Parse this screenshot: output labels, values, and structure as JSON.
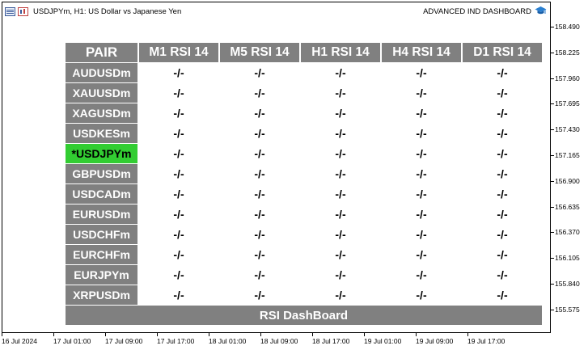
{
  "window": {
    "title": "USDJPYm, H1:  US Dollar vs Japanese Yen",
    "ea_name": "ADVANCED IND DASHBOARD"
  },
  "price_axis": [
    "158.490",
    "158.225",
    "157.960",
    "157.695",
    "157.430",
    "157.165",
    "156.900",
    "156.635",
    "156.370",
    "156.105",
    "155.840",
    "155.575"
  ],
  "time_axis": [
    "16 Jul 2024",
    "17 Jul 01:00",
    "17 Jul 09:00",
    "17 Jul 17:00",
    "18 Jul 01:00",
    "18 Jul 09:00",
    "18 Jul 17:00",
    "19 Jul 01:00",
    "19 Jul 09:00",
    "19 Jul 17:00"
  ],
  "dashboard": {
    "header": [
      "PAIR",
      "M1 RSI 14",
      "M5 RSI 14",
      "H1 RSI 14",
      "H4 RSI 14",
      "D1 RSI 14"
    ],
    "rows": [
      {
        "pair": "AUDUSDm",
        "values": [
          "-/-",
          "-/-",
          "-/-",
          "-/-",
          "-/-"
        ]
      },
      {
        "pair": "XAUUSDm",
        "values": [
          "-/-",
          "-/-",
          "-/-",
          "-/-",
          "-/-"
        ]
      },
      {
        "pair": "XAGUSDm",
        "values": [
          "-/-",
          "-/-",
          "-/-",
          "-/-",
          "-/-"
        ]
      },
      {
        "pair": "USDKESm",
        "values": [
          "-/-",
          "-/-",
          "-/-",
          "-/-",
          "-/-"
        ]
      },
      {
        "pair": "*USDJPYm",
        "values": [
          "-/-",
          "-/-",
          "-/-",
          "-/-",
          "-/-"
        ],
        "active": true
      },
      {
        "pair": "GBPUSDm",
        "values": [
          "-/-",
          "-/-",
          "-/-",
          "-/-",
          "-/-"
        ]
      },
      {
        "pair": "USDCADm",
        "values": [
          "-/-",
          "-/-",
          "-/-",
          "-/-",
          "-/-"
        ]
      },
      {
        "pair": "EURUSDm",
        "values": [
          "-/-",
          "-/-",
          "-/-",
          "-/-",
          "-/-"
        ]
      },
      {
        "pair": "USDCHFm",
        "values": [
          "-/-",
          "-/-",
          "-/-",
          "-/-",
          "-/-"
        ]
      },
      {
        "pair": "EURCHFm",
        "values": [
          "-/-",
          "-/-",
          "-/-",
          "-/-",
          "-/-"
        ]
      },
      {
        "pair": "EURJPYm",
        "values": [
          "-/-",
          "-/-",
          "-/-",
          "-/-",
          "-/-"
        ]
      },
      {
        "pair": "XRPUSDm",
        "values": [
          "-/-",
          "-/-",
          "-/-",
          "-/-",
          "-/-"
        ]
      }
    ],
    "footer": "RSI DashBoard"
  },
  "colors": {
    "header_bg": "#808080",
    "active_pair_bg": "#32cd32"
  }
}
